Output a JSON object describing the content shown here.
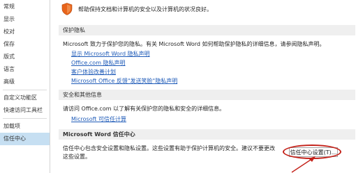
{
  "sidebar": {
    "items": [
      {
        "label": "常规"
      },
      {
        "label": "显示"
      },
      {
        "label": "校对"
      },
      {
        "label": "保存"
      },
      {
        "label": "版式"
      },
      {
        "label": "语言"
      },
      {
        "label": "高级"
      },
      {
        "label": "自定义功能区"
      },
      {
        "label": "快速访问工具栏"
      },
      {
        "label": "加载项"
      },
      {
        "label": "信任中心",
        "active": true
      }
    ]
  },
  "main": {
    "intro": "帮助保持文档和计算机的安全以及计算机的状况良好。",
    "privacy": {
      "header": "保护隐私",
      "description": "Microsoft 致力于保护您的隐私。有关 Microsoft Word 如何帮助保护隐私的详细信息，请参阅隐私声明。",
      "links": [
        "显示 Microsoft Word 隐私声明",
        "Office.com 隐私声明",
        "客户体验改善计划",
        "Microsoft Office 反馈\"发送笑脸\"隐私声明"
      ]
    },
    "security": {
      "header": "安全和其他信息",
      "description": "请访问 Office.com 以了解有关保护您的隐私和安全的详细信息。",
      "link": "Microsoft 可信任计算"
    },
    "trust_center": {
      "header": "Microsoft Word 信任中心",
      "description_line1": "信任中心包含安全设置和隐私设置。这些设置有助于保护计算机的安全。建议不要更改",
      "description_line2": "这些设置。",
      "button_label": "信任中心设置(T)..."
    }
  },
  "colors": {
    "accent_link": "#1f5bb8",
    "shield": "#e8641b",
    "highlight": "#c4221a",
    "selected_nav": "#c6dff2"
  }
}
